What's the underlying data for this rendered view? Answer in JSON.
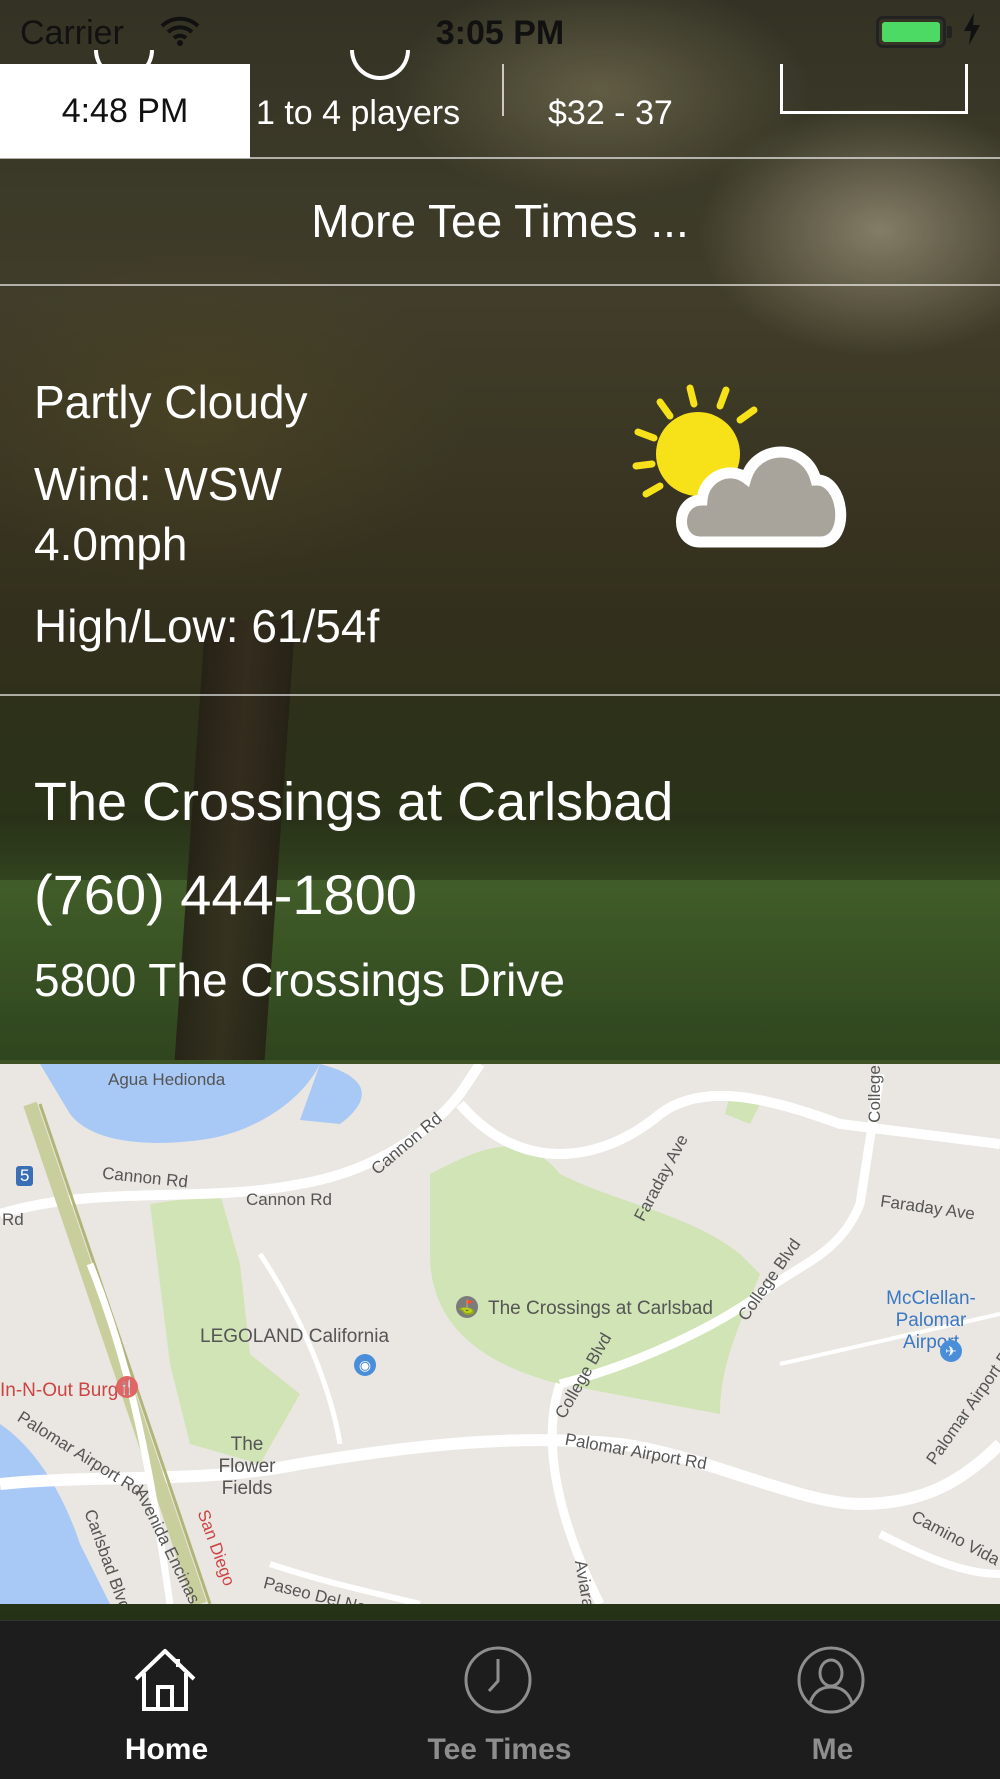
{
  "status_bar": {
    "carrier": "Carrier",
    "time": "3:05 PM",
    "battery_color": "#4cd964"
  },
  "tee_time_row": {
    "time": "4:48 PM",
    "players": "1 to 4 players",
    "price": "$32 - 37"
  },
  "more_tee_times": "More Tee Times ...",
  "weather": {
    "condition": "Partly Cloudy",
    "wind": "Wind: WSW 4.0mph",
    "high_low": "High/Low: 61/54f",
    "icon": "partly-cloudy-icon"
  },
  "course": {
    "name": "The Crossings at Carlsbad",
    "phone": "(760) 444-1800",
    "address": "5800 The Crossings Drive"
  },
  "map": {
    "labels": {
      "lagoon": "Agua Hedionda",
      "cannon_rd_1": "Cannon Rd",
      "cannon_rd_2": "Cannon Rd",
      "cannon_rd_3": "Cannon Rd",
      "faraday_ave_1": "Faraday Ave",
      "faraday_ave_2": "Faraday Ave",
      "college_1": "College",
      "college_blvd_1": "College Blvd",
      "college_blvd_2": "College Blvd",
      "crossings": "The Crossings at Carlsbad",
      "legoland": "LEGOLAND California",
      "mcclellan": "McClellan-Palomar Airport",
      "in_n_out": "In-N-Out Burger",
      "flower_fields": "The Flower Fields",
      "palomar_1": "Palomar Airport Rd",
      "palomar_2": "Palomar Airport Rd",
      "palomar_3": "Palomar Airport Rd",
      "avenida": "Avenida Encinas",
      "carlsbad_blvd": "Carlsbad Blvd",
      "san_diego": "San Diego",
      "paseo": "Paseo Del Norte",
      "camino": "Camino Vida Roble",
      "rd": "Rd",
      "interstate": "5",
      "aviara": "Aviara"
    }
  },
  "tab_bar": {
    "tabs": [
      {
        "label": "Home",
        "icon": "home-icon",
        "active": true
      },
      {
        "label": "Tee Times",
        "icon": "clock-icon",
        "active": false
      },
      {
        "label": "Me",
        "icon": "person-icon",
        "active": false
      }
    ],
    "active_color": "#ffffff",
    "inactive_color": "#8e8e8e"
  }
}
